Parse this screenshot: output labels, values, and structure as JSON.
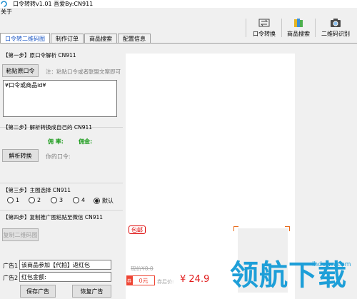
{
  "window": {
    "title": "口令转转v1.01  吾爱By:CN911"
  },
  "menu": {
    "items": [
      "关于"
    ]
  },
  "toolbar": {
    "buttons": [
      {
        "label": "口令转换",
        "icon": "convert-icon"
      },
      {
        "label": "商品搜索",
        "icon": "books-icon"
      },
      {
        "label": "二维码识别",
        "icon": "camera-icon"
      }
    ]
  },
  "tabs": [
    {
      "label": "口令转二维码图",
      "active": true
    },
    {
      "label": "制作订单",
      "active": false
    },
    {
      "label": "商品搜索",
      "active": false
    },
    {
      "label": "配置信息",
      "active": false
    }
  ],
  "step1": {
    "title": "【第一步】原口令解析 CN911",
    "paste_button": "粘贴原口令",
    "hint": "注：粘贴口令或者联盟文案即可",
    "input_placeholder": "¥口令或商品id¥"
  },
  "step2": {
    "title": "【第二步】解析转换成自己的 CN911",
    "rate_label": "佣 率:",
    "commission_label": "佣金:",
    "convert_button": "解析转换",
    "your_code_label": "你的口令:"
  },
  "step3": {
    "title": "【第三步】主图选择 CN911",
    "options": [
      {
        "label": "1",
        "checked": false
      },
      {
        "label": "2",
        "checked": false
      },
      {
        "label": "3",
        "checked": false
      },
      {
        "label": "4",
        "checked": false
      },
      {
        "label": "默认",
        "checked": true
      }
    ]
  },
  "step4": {
    "title": "【第四步】复制推广图粘贴至微信 CN911",
    "copy_button": "复制二维码图"
  },
  "ads": {
    "ad1_label": "广告1",
    "ad1_value": "该商品参加【代拍】返红包",
    "ad2_label": "广告2",
    "ad2_value": "红包金额:",
    "save_button": "保存广告",
    "restore_button": "恢复广告"
  },
  "preview": {
    "badge": "包邮",
    "original_price": "现价¥0.0",
    "coupon_prefix": "券",
    "coupon_amount": "0元",
    "final_label": "券后价:",
    "final_price": "¥ 24.9"
  },
  "watermark": {
    "text": "领航下载",
    "domain": "lhdown.com"
  },
  "colors": {
    "accent": "#1a56c4",
    "commission_green": "#1a9b1a",
    "price_red": "#e01a1a",
    "watermark_blue": "#1e9fd8"
  }
}
